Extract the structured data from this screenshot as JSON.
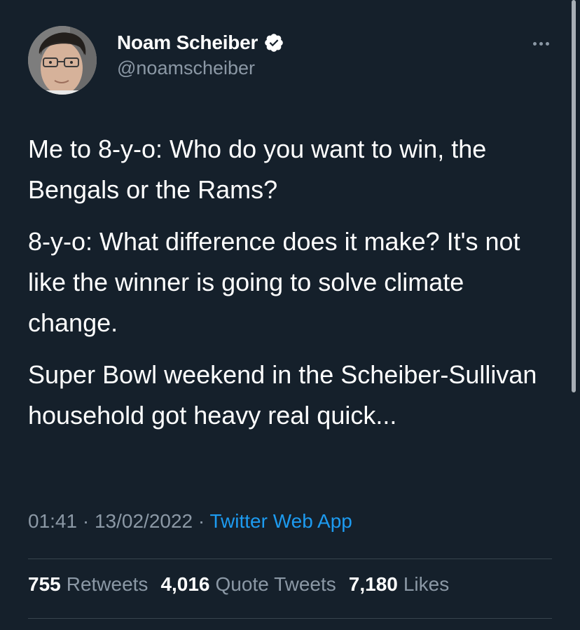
{
  "author": {
    "display_name": "Noam Scheiber",
    "handle": "@noamscheiber",
    "verified": true
  },
  "tweet": {
    "paragraphs": [
      "Me to 8-y-o: Who do you want to win, the Bengals or the Rams?",
      "8-y-o: What difference does it make? It's not like the winner is going to solve climate change.",
      "Super Bowl weekend in the Scheiber-Sullivan household got heavy real quick..."
    ],
    "time": "01:41",
    "separator": "·",
    "date": "13/02/2022",
    "source": "Twitter Web App"
  },
  "stats": {
    "retweets_count": "755",
    "retweets_label": "Retweets",
    "quotes_count": "4,016",
    "quotes_label": "Quote Tweets",
    "likes_count": "7,180",
    "likes_label": "Likes"
  },
  "icons": {
    "verified": "verified-badge-icon",
    "more": "more-horizontal-icon"
  },
  "colors": {
    "background": "#15202b",
    "text_primary": "#ffffff",
    "text_secondary": "#8b98a5",
    "link": "#1d9bf0",
    "divider": "#38444d"
  }
}
